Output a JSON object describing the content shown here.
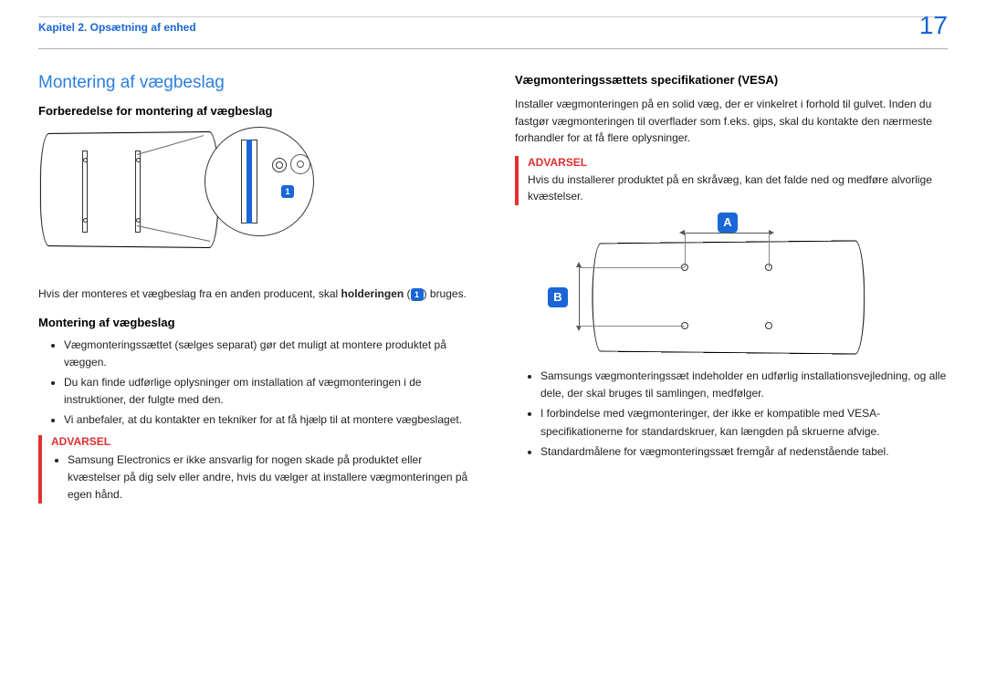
{
  "header": {
    "chapter": "Kapitel 2. Opsætning af enhed",
    "page_number": "17"
  },
  "left": {
    "h1": "Montering af vægbeslag",
    "prep_heading": "Forberedelse for montering af vægbeslag",
    "image_badge": "1",
    "paragraph_before_badge": "Hvis der monteres et vægbeslag fra en anden producent, skal ",
    "paragraph_bold": "holderingen",
    "paragraph_after_badge": " bruges.",
    "paragraph_open": " (",
    "paragraph_close": ") ",
    "mount_heading": "Montering af vægbeslag",
    "bullets": [
      "Vægmonteringssættet (sælges separat) gør det muligt at montere produktet på væggen.",
      "Du kan finde udførlige oplysninger om installation af vægmonteringen i de instruktioner, der fulgte med den.",
      "Vi anbefaler, at du kontakter en tekniker for at få hjælp til at montere vægbeslaget."
    ],
    "warning": {
      "title": "ADVARSEL",
      "text": "Samsung Electronics er ikke ansvarlig for nogen skade på produktet eller kvæstelser på dig selv eller andre, hvis du vælger at installere vægmonteringen på egen hånd."
    }
  },
  "right": {
    "heading": "Vægmonteringssættets specifikationer (VESA)",
    "paragraph": "Installer vægmonteringen på en solid væg, der er vinkelret i forhold til gulvet. Inden du fastgør vægmonteringen til overflader som f.eks. gips, skal du kontakte den nærmeste forhandler for at få flere oplysninger.",
    "warning": {
      "title": "ADVARSEL",
      "text": "Hvis du installerer produktet på en skråvæg, kan det falde ned og medføre alvorlige kvæstelser."
    },
    "label_a": "A",
    "label_b": "B",
    "bullets": [
      "Samsungs vægmonteringssæt indeholder en udførlig installationsvejledning, og alle dele, der skal bruges til samlingen, medfølger.",
      "I forbindelse med vægmonteringer, der ikke er kompatible med VESA-specifikationerne for standardskruer, kan længden på skruerne afvige.",
      "Standardmålene for vægmonteringssæt fremgår af nedenstående tabel."
    ]
  }
}
